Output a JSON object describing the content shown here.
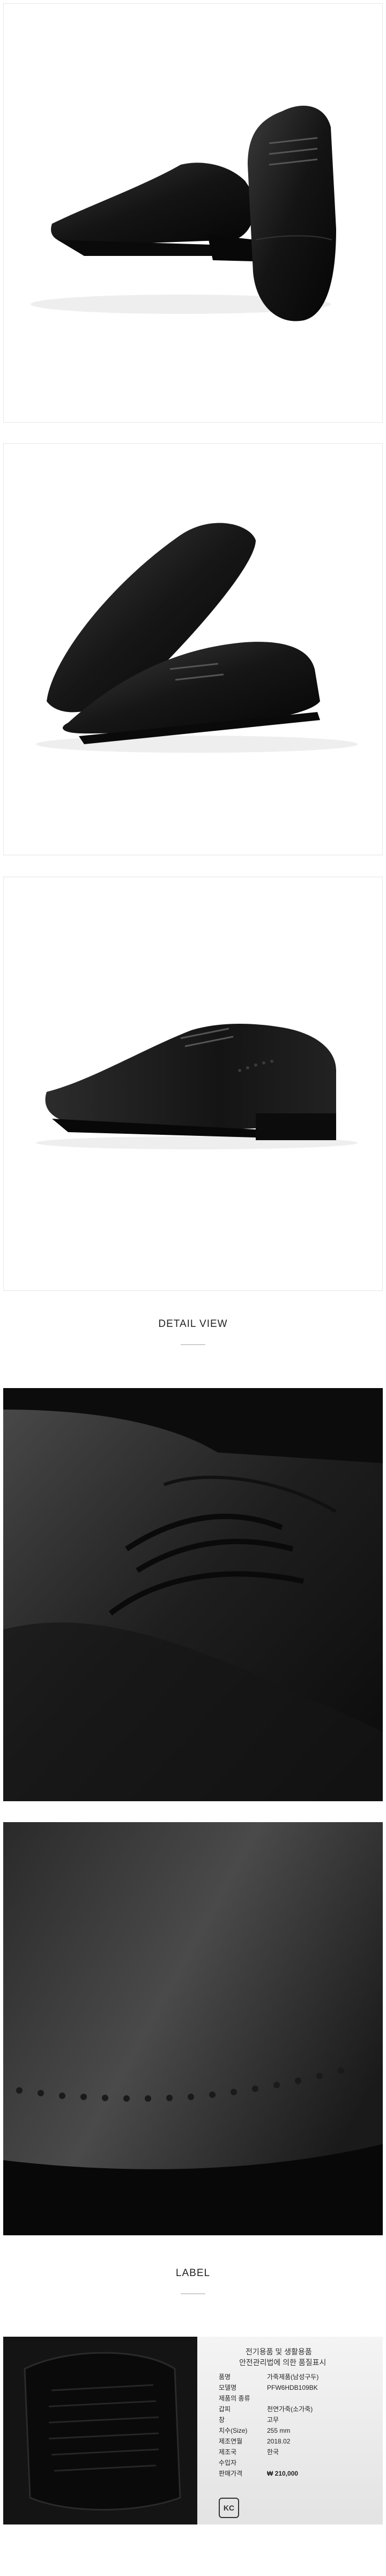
{
  "sections": {
    "detail_heading": "DETAIL VIEW",
    "label_heading": "LABEL"
  },
  "label_tag": {
    "title_line1": "전기용품 및 생활용품",
    "title_line2": "안전관리법에 의한 품질표시",
    "rows": [
      {
        "key": "품명",
        "value": "가죽제품(남성구두)"
      },
      {
        "key": "모델명",
        "value": "PFW6HDB109BK"
      },
      {
        "key": "제품의 종류",
        "value": ""
      },
      {
        "key": "갑피",
        "value": "천연가죽(소가죽)"
      },
      {
        "key": "창",
        "value": "고무"
      },
      {
        "key": "치수(Size)",
        "value": "255 mm"
      },
      {
        "key": "제조연월",
        "value": "2018.02"
      },
      {
        "key": "제조국",
        "value": "한국"
      },
      {
        "key": "수입자",
        "value": ""
      },
      {
        "key": "판매가격",
        "value": "₩ 210,000"
      }
    ],
    "kc_mark": "KC"
  },
  "colors": {
    "background": "#ffffff",
    "leather": "#1b1b1b",
    "border": "#e6e6e6"
  }
}
